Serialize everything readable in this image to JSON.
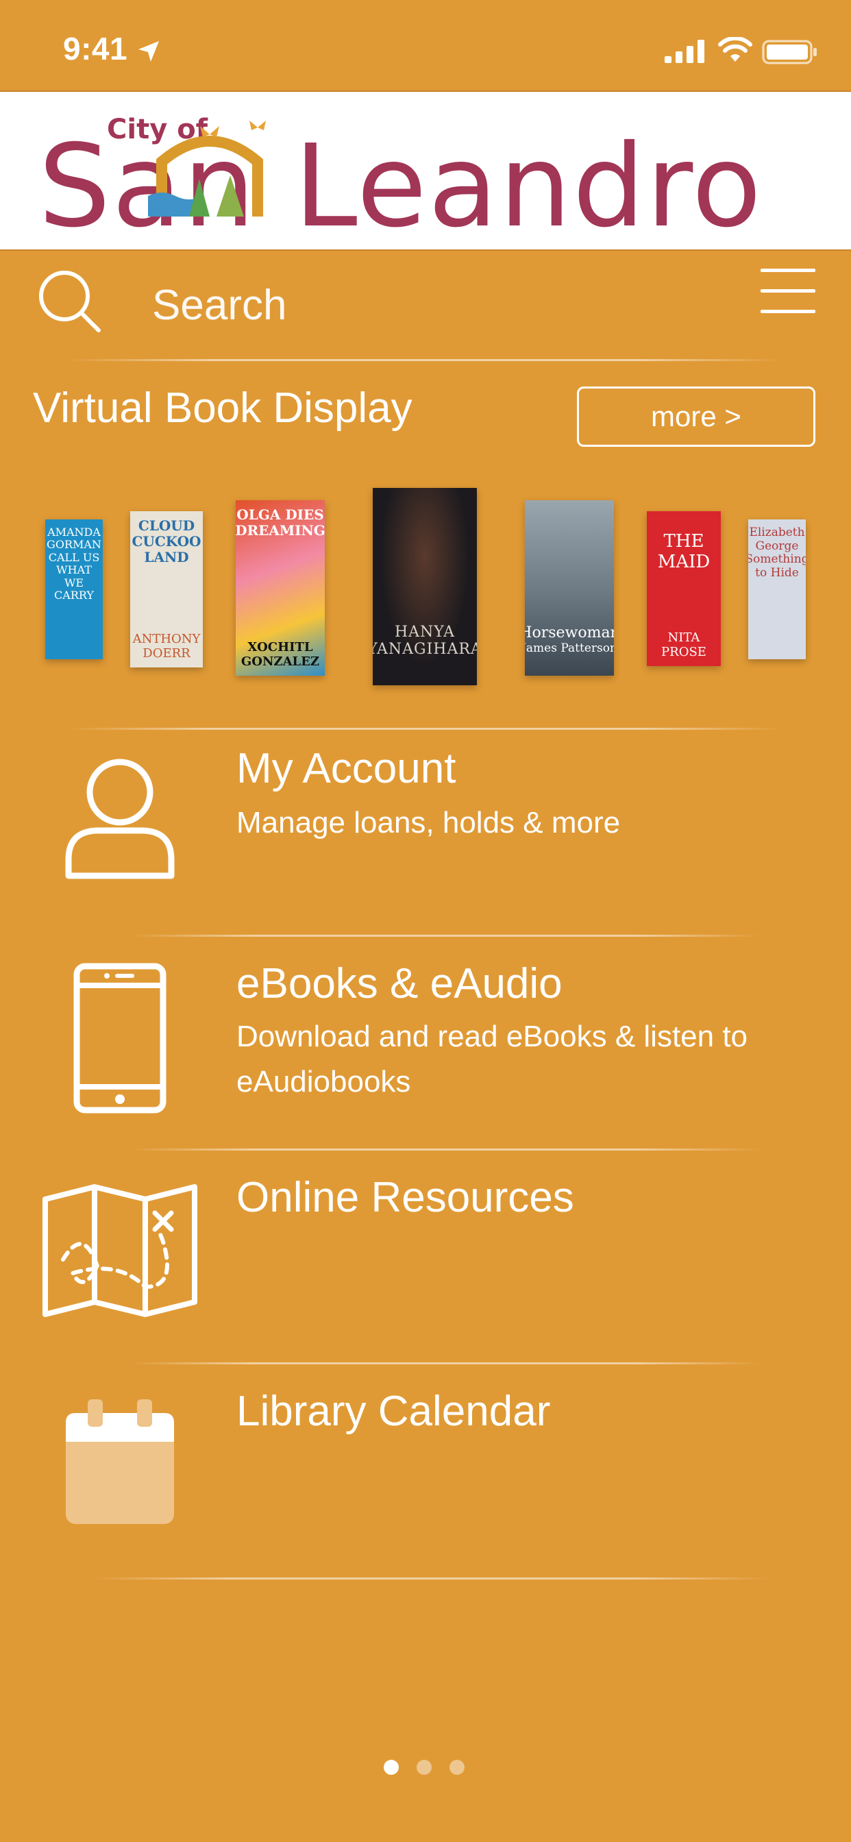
{
  "status_bar": {
    "time": "9:41"
  },
  "header": {
    "logo_small": "City of",
    "logo_main": "San Leandro"
  },
  "search": {
    "placeholder": "Search"
  },
  "book_display": {
    "title": "Virtual Book Display",
    "more_label": "more >",
    "books": [
      {
        "title": "AMANDA GORMAN CALL US WHAT WE CARRY",
        "author": "",
        "color": "#1E8FC6"
      },
      {
        "title": "CLOUD CUCKOO LAND",
        "author": "ANTHONY DOERR",
        "color": "#E8E3D6"
      },
      {
        "title": "OLGA DIES DREAMING",
        "author": "XOCHITL GONZALEZ",
        "color": "#E2502A"
      },
      {
        "title": "HANYA YANAGIHARA",
        "author": "",
        "color": "#1C1A1E"
      },
      {
        "title": "Horsewoman",
        "author": "James Patterson",
        "color": "#6F7C86"
      },
      {
        "title": "THE MAID",
        "author": "NITA PROSE",
        "color": "#D9262C"
      },
      {
        "title": "Elizabeth George Something to Hide",
        "author": "",
        "color": "#D5DAE4"
      }
    ]
  },
  "menu": [
    {
      "title": "My Account",
      "subtitle": "Manage loans, holds & more",
      "icon": "user-icon"
    },
    {
      "title": "eBooks & eAudio",
      "subtitle": "Download and read eBooks & listen to eAudiobooks",
      "icon": "tablet-icon"
    },
    {
      "title": "Online Resources",
      "subtitle": "",
      "icon": "map-icon"
    },
    {
      "title": "Library Calendar",
      "subtitle": "",
      "icon": "calendar-icon"
    }
  ],
  "pagination": {
    "current": 1,
    "total": 3
  }
}
